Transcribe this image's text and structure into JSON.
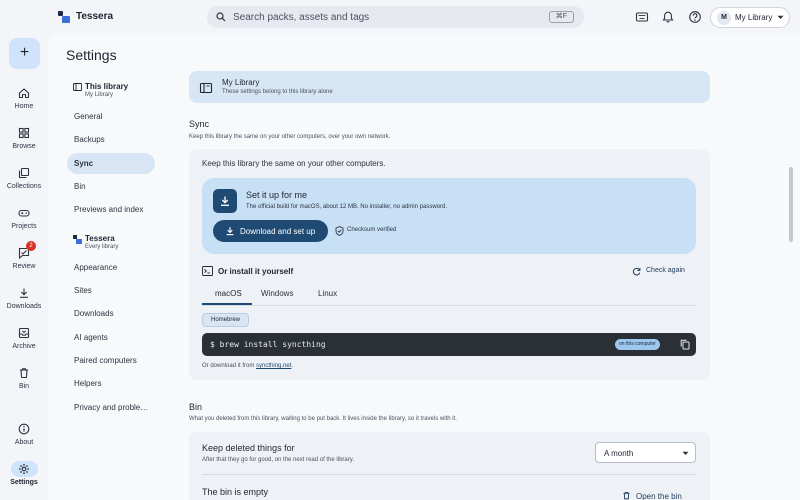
{
  "app": {
    "name": "Tessera"
  },
  "search": {
    "placeholder": "Search packs, assets and tags",
    "shortcut": "⌘F"
  },
  "topbar": {
    "library_avatar": "M",
    "library_label": "My Library"
  },
  "rail": {
    "items": [
      {
        "label": "Home",
        "icon": "home-icon"
      },
      {
        "label": "Browse",
        "icon": "grid-icon"
      },
      {
        "label": "Collections",
        "icon": "collections-icon"
      },
      {
        "label": "Projects",
        "icon": "gamepad-icon"
      },
      {
        "label": "Review",
        "icon": "review-icon",
        "badge": "2"
      },
      {
        "label": "Downloads",
        "icon": "download-icon"
      },
      {
        "label": "Archive",
        "icon": "archive-icon"
      },
      {
        "label": "Bin",
        "icon": "trash-icon"
      }
    ],
    "about": "About",
    "settings": "Settings"
  },
  "page": {
    "title": "Settings"
  },
  "nav": {
    "library_group": {
      "title": "This library",
      "subtitle": "My Library"
    },
    "library_items": [
      "General",
      "Backups",
      "Sync",
      "Bin",
      "Previews and index"
    ],
    "app_group": {
      "title": "Tessera",
      "subtitle": "Every library"
    },
    "app_items": [
      "Appearance",
      "Sites",
      "Downloads",
      "AI agents",
      "Paired computers",
      "Helpers",
      "Privacy and proble…"
    ],
    "active": "Sync"
  },
  "banner": {
    "title": "My Library",
    "subtitle": "These settings belong to this library alone"
  },
  "sync": {
    "title": "Sync",
    "subtitle": "Keep this library the same on your other computers, over your own network.",
    "lead": "Keep this library the same on your other computers.",
    "setup_title": "Set it up for me",
    "setup_subtitle": "The official build for macOS, about 12 MB. No installer, no admin password.",
    "download_button": "Download and set up",
    "checksum": "Checksum verified",
    "or_install": "Or install it yourself",
    "check_again": "Check again",
    "tabs": [
      "macOS",
      "Windows",
      "Linux"
    ],
    "active_tab": "macOS",
    "method_chip": "Homebrew",
    "command": "$ brew install syncthing",
    "command_badge": "on this computer",
    "download_prefix": "Or download it from ",
    "download_link": "syncthing.net",
    "download_suffix": "."
  },
  "bin": {
    "title": "Bin",
    "subtitle": "What you deleted from this library, waiting to be put back. It lives inside the library, so it travels with it.",
    "keep_title": "Keep deleted things for",
    "keep_subtitle": "After that they go for good, on the next read of the library.",
    "keep_value": "A month",
    "empty_title": "The bin is empty",
    "open_button": "Open the bin"
  },
  "colors": {
    "accent": "#1f4a73",
    "accent_light": "#c8e0f6",
    "badge": "#d93025"
  }
}
